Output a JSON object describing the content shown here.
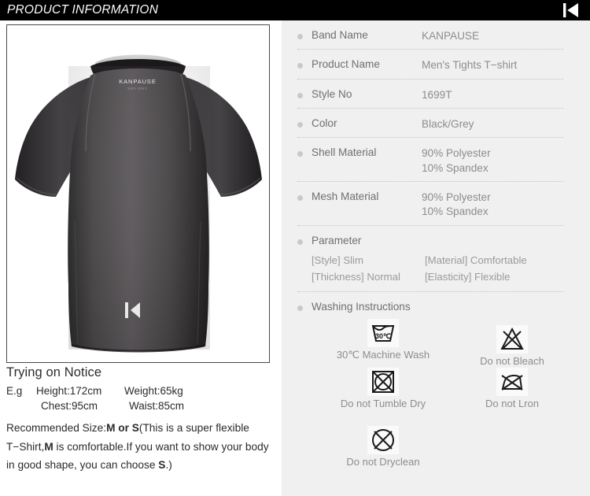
{
  "header": {
    "title": "PRODUCT INFORMATION",
    "logo_icon": "skip-back-logo-icon"
  },
  "product_image": {
    "alt": "Men's black short sleeve tights T-shirt on mannequin",
    "neck_label_brand": "KANPAUSE",
    "neck_label_sub": "DRY-DRY",
    "chest_logo_icon": "k-mark-logo-icon"
  },
  "notice": {
    "title": "Trying on Notice",
    "eg_label": "E.g",
    "height": "Height:172cm",
    "weight": "Weight:65kg",
    "chest": "Chest:95cm",
    "waist": "Waist:85cm",
    "recommend_pre": "Recommended Size:",
    "recommend_bold1": "M or S",
    "recommend_mid1": "(This is a super flexible T−Shirt,",
    "recommend_bold2": "M",
    "recommend_mid2": " is comfortable.If you want to show your body in good shape, you can choose ",
    "recommend_bold3": "S",
    "recommend_end": ".)"
  },
  "specs": [
    {
      "label": "Band Name",
      "value": "KANPAUSE"
    },
    {
      "label": "Product Name",
      "value": "Men's Tights T−shirt"
    },
    {
      "label": "Style No",
      "value": "1699T"
    },
    {
      "label": "Color",
      "value": "Black/Grey"
    },
    {
      "label": "Shell Material",
      "value": "90% Polyester\n10% Spandex"
    },
    {
      "label": "Mesh Material",
      "value": "90% Polyester\n10% Spandex"
    }
  ],
  "parameter": {
    "label": "Parameter",
    "items": [
      {
        "key": "[Style]",
        "val": "Slim"
      },
      {
        "key": "[Material]",
        "val": "Comfortable"
      },
      {
        "key": "[Thickness]",
        "val": "Normal"
      },
      {
        "key": "[Elasticity]",
        "val": "Flexible"
      }
    ]
  },
  "washing": {
    "label": "Washing Instructions",
    "items": [
      {
        "caption": "30℃ Machine Wash",
        "icon": "machine-wash-30c-icon"
      },
      {
        "caption": "Do not Bleach",
        "icon": "do-not-bleach-icon"
      },
      {
        "caption": "Do not Tumble Dry",
        "icon": "do-not-tumble-dry-icon"
      },
      {
        "caption": "Do not Lron",
        "icon": "do-not-iron-icon"
      },
      {
        "caption": "Do not Dryclean",
        "icon": "do-not-dryclean-icon"
      }
    ]
  },
  "colors": {
    "header_bg": "#000000",
    "header_text": "#ffffff",
    "right_panel_bg": "#f0f0f0",
    "label_text": "#6f6f6f",
    "value_text": "#8d8d8d",
    "bullet": "#c9c9c9",
    "rule": "#c3c3c3",
    "notice_text": "#2b2b2b"
  }
}
